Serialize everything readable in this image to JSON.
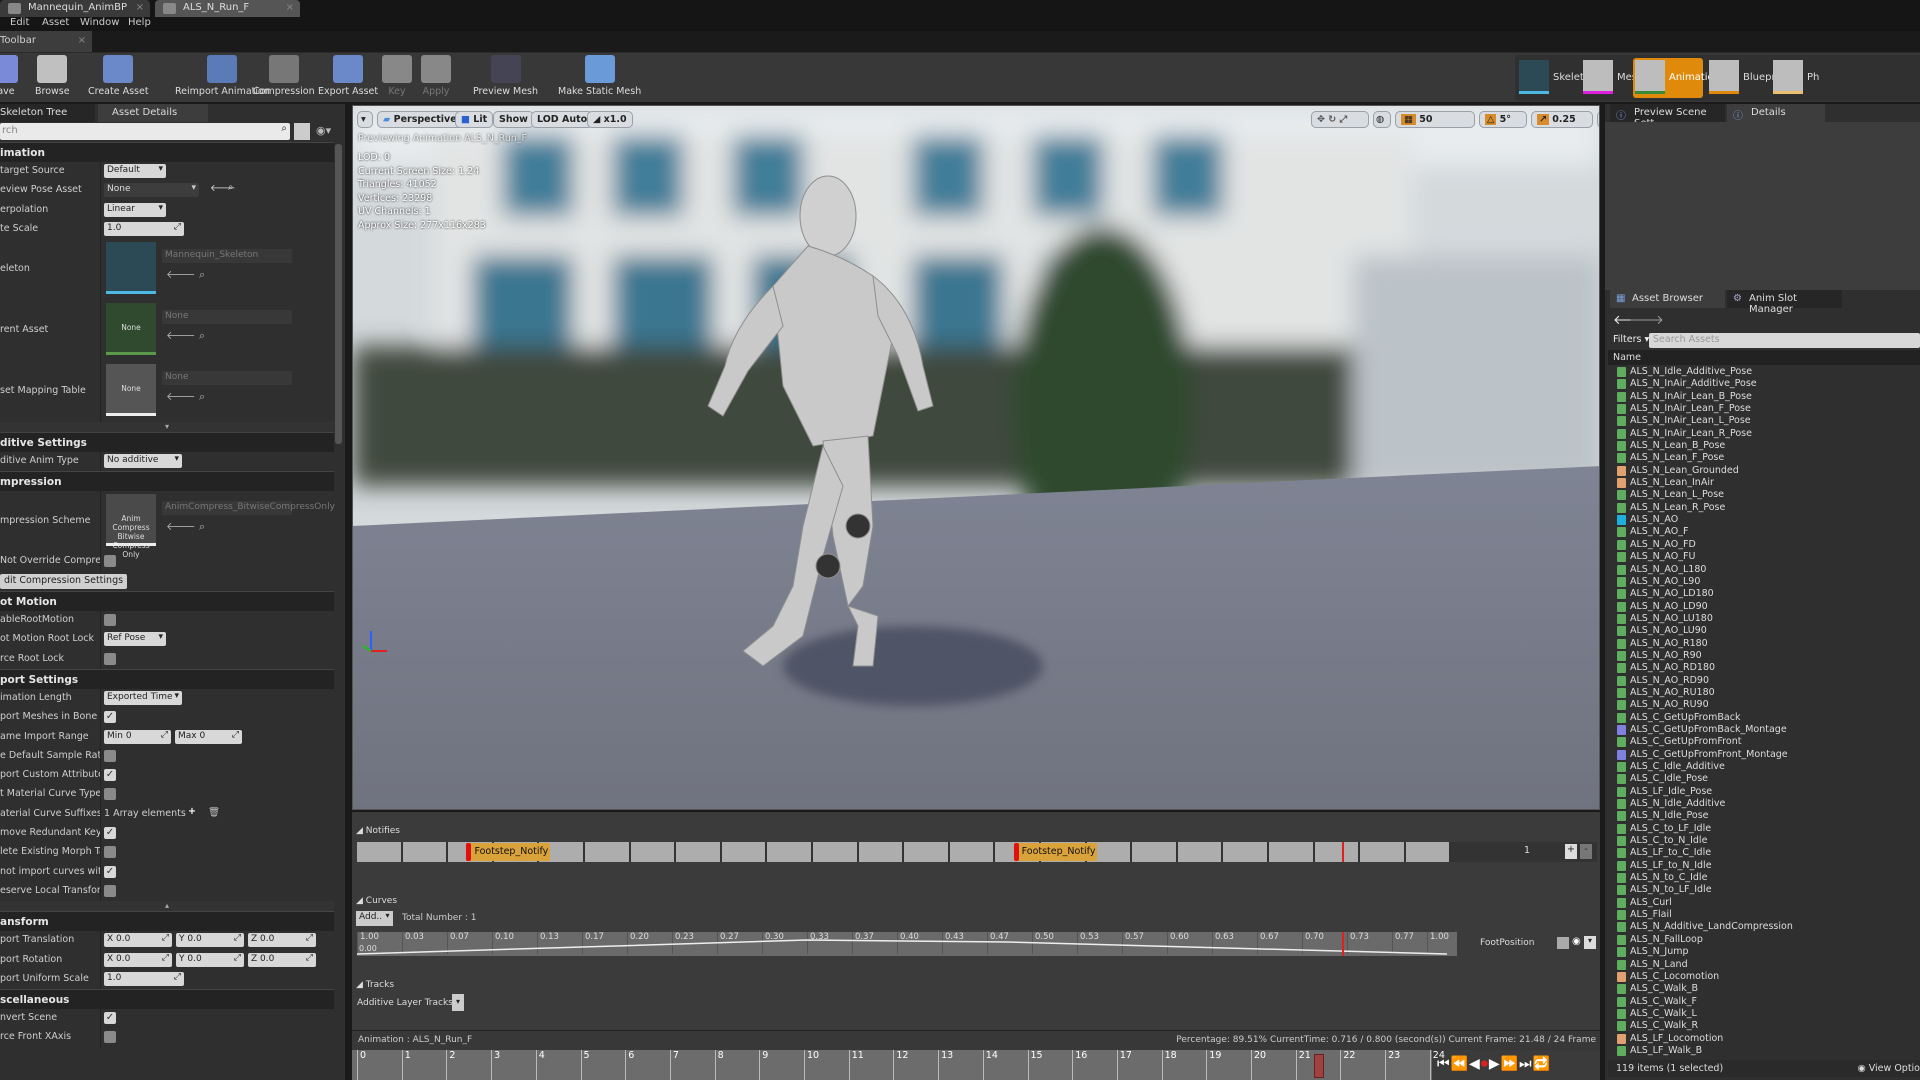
{
  "doc_tabs": [
    {
      "label": "Mannequin_AnimBP",
      "active": false
    },
    {
      "label": "ALS_N_Run_F",
      "active": true
    }
  ],
  "menu": [
    "Edit",
    "Asset",
    "Window",
    "Help"
  ],
  "toolbar_tab": "Toolbar",
  "toolbar": [
    {
      "label": "Save",
      "icon": "save-icon",
      "disabled": false
    },
    {
      "label": "Browse",
      "icon": "browse-icon",
      "disabled": false
    },
    {
      "label": "Create Asset",
      "icon": "create-asset-icon",
      "disabled": false
    },
    {
      "label": "Reimport Animation",
      "icon": "reimport-icon",
      "disabled": false
    },
    {
      "label": "Compression",
      "icon": "compression-icon",
      "disabled": false
    },
    {
      "label": "Export Asset",
      "icon": "export-icon",
      "disabled": false
    },
    {
      "label": "Key",
      "icon": "plus-icon",
      "disabled": true
    },
    {
      "label": "Apply",
      "icon": "check-icon",
      "disabled": true
    },
    {
      "label": "Preview Mesh",
      "icon": "preview-mesh-icon",
      "disabled": false
    },
    {
      "label": "Make Static Mesh",
      "icon": "static-mesh-icon",
      "disabled": false
    }
  ],
  "modes": [
    {
      "label": "Skeleton",
      "active": false,
      "color": "#4fb8e0"
    },
    {
      "label": "Mesh",
      "active": false,
      "color": "#e020e0"
    },
    {
      "label": "Animation",
      "active": true,
      "color": "#3a8a3a"
    },
    {
      "label": "Blueprint",
      "active": false,
      "color": "#e08a0b"
    },
    {
      "label": "Ph",
      "active": false,
      "color": "#e8c070"
    }
  ],
  "left_panel": {
    "tabs": [
      "Skeleton Tree",
      "Asset Details"
    ],
    "search_placeholder": "rch",
    "rows": [
      {
        "t": "sec",
        "label": "imation"
      },
      {
        "t": "dd",
        "label": "target Source",
        "value": "Default"
      },
      {
        "t": "dd2",
        "label": "eview Pose Asset",
        "value": "None"
      },
      {
        "t": "dd",
        "label": "erpolation",
        "value": "Linear"
      },
      {
        "t": "spin",
        "label": "te Scale",
        "value": "1.0"
      },
      {
        "t": "thumb",
        "label": "eleton",
        "thumb": "",
        "name": "Mannequin_Skeleton",
        "bg": "#2c4a56"
      },
      {
        "t": "thumb",
        "label": "rent Asset",
        "thumb": "None",
        "name": "None",
        "bg": "#2f4a2f"
      },
      {
        "t": "thumb",
        "label": "set Mapping Table",
        "thumb": "None",
        "name": "None",
        "bg": "#555555"
      },
      {
        "t": "arrow",
        "label": "▾"
      },
      {
        "t": "sec",
        "label": "ditive Settings"
      },
      {
        "t": "dd",
        "label": "ditive Anim Type",
        "value": "No additive"
      },
      {
        "t": "sec",
        "label": "mpression"
      },
      {
        "t": "thumb",
        "label": "mpression Scheme",
        "thumb": "Anim Compress Bitwise Compress Only",
        "name": "AnimCompress_BitwiseCompressOnly",
        "bg": "#4a4a4a"
      },
      {
        "t": "cb",
        "label": "Not Override Compressio",
        "checked": false
      },
      {
        "t": "btn",
        "label": "dit Compression Settings"
      },
      {
        "t": "sec",
        "label": "ot Motion"
      },
      {
        "t": "cb",
        "label": "ableRootMotion",
        "checked": false
      },
      {
        "t": "dd",
        "label": "ot Motion Root Lock",
        "value": "Ref Pose"
      },
      {
        "t": "cb",
        "label": "rce Root Lock",
        "checked": false
      },
      {
        "t": "sec",
        "label": "port Settings"
      },
      {
        "t": "dd",
        "label": "imation Length",
        "value": "Exported Time"
      },
      {
        "t": "cb",
        "label": "port Meshes in Bone Hiera",
        "checked": true
      },
      {
        "t": "range",
        "label": "ame Import Range",
        "values": [
          "Min  0",
          "Max  0"
        ]
      },
      {
        "t": "cb",
        "label": "e Default Sample Rate",
        "checked": false
      },
      {
        "t": "cb",
        "label": "port Custom Attribute",
        "checked": true
      },
      {
        "t": "cb",
        "label": "t Material Curve Type",
        "checked": false
      },
      {
        "t": "arr",
        "label": "aterial Curve Suffixes",
        "value": "1 Array elements"
      },
      {
        "t": "cb",
        "label": "move Redundant Keys",
        "checked": true
      },
      {
        "t": "cb",
        "label": "lete Existing Morph Target",
        "checked": false
      },
      {
        "t": "cb",
        "label": "not import curves with on",
        "checked": true
      },
      {
        "t": "cb",
        "label": "eserve Local Transform",
        "checked": false
      },
      {
        "t": "arrow",
        "label": "▴"
      },
      {
        "t": "sec",
        "label": "ansform"
      },
      {
        "t": "xyz",
        "label": "port Translation",
        "values": [
          "X  0.0",
          "Y  0.0",
          "Z  0.0"
        ]
      },
      {
        "t": "xyz",
        "label": "port Rotation",
        "values": [
          "X  0.0",
          "Y  0.0",
          "Z  0.0"
        ]
      },
      {
        "t": "spin",
        "label": "port Uniform Scale",
        "value": "1.0"
      },
      {
        "t": "sec",
        "label": "scellaneous"
      },
      {
        "t": "cb",
        "label": "nvert Scene",
        "checked": true
      },
      {
        "t": "cb",
        "label": "rce Front XAxis",
        "checked": false
      }
    ]
  },
  "viewport": {
    "buttons": [
      "Perspective",
      "Lit",
      "Show",
      "LOD Auto",
      "x1.0"
    ],
    "right_controls": [
      "50",
      "5°",
      "0.25",
      "4"
    ],
    "previewing": "Previewing Animation ALS_N_Run_F",
    "info": [
      "LOD: 0",
      "Current Screen Size: 1.24",
      "Triangles: 41052",
      "Vertices: 23298",
      "UV Channels: 1",
      "Approx Size: 277x116x283"
    ]
  },
  "right_panel": {
    "top_tabs": [
      "Preview Scene Sett",
      "Details"
    ],
    "browser_tabs": [
      "Asset Browser",
      "Anim Slot Manager"
    ],
    "filters": "Filters",
    "search_placeholder": "Search Assets",
    "column": "Name",
    "icon_colors": {
      "anim": "#5fae5f",
      "blend": "#e0a070",
      "aimoffset": "#20b0e0",
      "montage": "#8080e0"
    },
    "assets": [
      [
        "ALS_N_Idle_Additive_Pose",
        "anim"
      ],
      [
        "ALS_N_InAir_Additive_Pose",
        "anim"
      ],
      [
        "ALS_N_InAir_Lean_B_Pose",
        "anim"
      ],
      [
        "ALS_N_InAir_Lean_F_Pose",
        "anim"
      ],
      [
        "ALS_N_InAir_Lean_L_Pose",
        "anim"
      ],
      [
        "ALS_N_InAir_Lean_R_Pose",
        "anim"
      ],
      [
        "ALS_N_Lean_B_Pose",
        "anim"
      ],
      [
        "ALS_N_Lean_F_Pose",
        "anim"
      ],
      [
        "ALS_N_Lean_Grounded",
        "blend"
      ],
      [
        "ALS_N_Lean_InAir",
        "blend"
      ],
      [
        "ALS_N_Lean_L_Pose",
        "anim"
      ],
      [
        "ALS_N_Lean_R_Pose",
        "anim"
      ],
      [
        "ALS_N_AO",
        "aimoffset"
      ],
      [
        "ALS_N_AO_F",
        "anim"
      ],
      [
        "ALS_N_AO_FD",
        "anim"
      ],
      [
        "ALS_N_AO_FU",
        "anim"
      ],
      [
        "ALS_N_AO_L180",
        "anim"
      ],
      [
        "ALS_N_AO_L90",
        "anim"
      ],
      [
        "ALS_N_AO_LD180",
        "anim"
      ],
      [
        "ALS_N_AO_LD90",
        "anim"
      ],
      [
        "ALS_N_AO_LU180",
        "anim"
      ],
      [
        "ALS_N_AO_LU90",
        "anim"
      ],
      [
        "ALS_N_AO_R180",
        "anim"
      ],
      [
        "ALS_N_AO_R90",
        "anim"
      ],
      [
        "ALS_N_AO_RD180",
        "anim"
      ],
      [
        "ALS_N_AO_RD90",
        "anim"
      ],
      [
        "ALS_N_AO_RU180",
        "anim"
      ],
      [
        "ALS_N_AO_RU90",
        "anim"
      ],
      [
        "ALS_C_GetUpFromBack",
        "anim"
      ],
      [
        "ALS_C_GetUpFromBack_Montage",
        "montage"
      ],
      [
        "ALS_C_GetUpFromFront",
        "anim"
      ],
      [
        "ALS_C_GetUpFromFront_Montage",
        "montage"
      ],
      [
        "ALS_C_Idle_Additive",
        "anim"
      ],
      [
        "ALS_C_Idle_Pose",
        "anim"
      ],
      [
        "ALS_LF_Idle_Pose",
        "anim"
      ],
      [
        "ALS_N_Idle_Additive",
        "anim"
      ],
      [
        "ALS_N_Idle_Pose",
        "anim"
      ],
      [
        "ALS_C_to_LF_Idle",
        "anim"
      ],
      [
        "ALS_C_to_N_Idle",
        "anim"
      ],
      [
        "ALS_LF_to_C_Idle",
        "anim"
      ],
      [
        "ALS_LF_to_N_Idle",
        "anim"
      ],
      [
        "ALS_N_to_C_Idle",
        "anim"
      ],
      [
        "ALS_N_to_LF_Idle",
        "anim"
      ],
      [
        "ALS_Curl",
        "anim"
      ],
      [
        "ALS_Flail",
        "anim"
      ],
      [
        "ALS_N_Additive_LandCompression",
        "anim"
      ],
      [
        "ALS_N_FallLoop",
        "anim"
      ],
      [
        "ALS_N_Jump",
        "anim"
      ],
      [
        "ALS_N_Land",
        "anim"
      ],
      [
        "ALS_C_Locomotion",
        "blend"
      ],
      [
        "ALS_C_Walk_B",
        "anim"
      ],
      [
        "ALS_C_Walk_F",
        "anim"
      ],
      [
        "ALS_C_Walk_L",
        "anim"
      ],
      [
        "ALS_C_Walk_R",
        "anim"
      ],
      [
        "ALS_LF_Locomotion",
        "blend"
      ],
      [
        "ALS_LF_Walk_B",
        "anim"
      ]
    ],
    "footer": "119 items (1 selected)",
    "view_options": "View Optio"
  },
  "bottom": {
    "notifies_label": "Notifies",
    "notifies": [
      {
        "label": "Footstep_Notify",
        "frame": 2.4
      },
      {
        "label": "Footstep_Notify",
        "frame": 14.4
      }
    ],
    "track_count": "1",
    "curves_label": "Curves",
    "add_label": "Add...",
    "total": "Total Number : 1",
    "curve_ticks": [
      "1.00",
      "0.03",
      "0.07",
      "0.10",
      "0.13",
      "0.17",
      "0.20",
      "0.23",
      "0.27",
      "0.30",
      "0.33",
      "0.37",
      "0.40",
      "0.43",
      "0.47",
      "0.50",
      "0.53",
      "0.57",
      "0.60",
      "0.63",
      "0.67",
      "0.70",
      "0.73",
      "0.77",
      "1.00"
    ],
    "curve_min": "0.00",
    "curve_name": "FootPosition",
    "tracks_label": "Tracks",
    "additive_tracks": "Additive Layer Tracks",
    "animation": "Animation :  ALS_N_Run_F",
    "status": "Percentage:  89.51% CurrentTime:  0.716 / 0.800 (second(s)) Current Frame:  21.48 / 24 Frame",
    "frames": [
      "0",
      "1",
      "2",
      "3",
      "4",
      "5",
      "6",
      "7",
      "8",
      "9",
      "10",
      "11",
      "12",
      "13",
      "14",
      "15",
      "16",
      "17",
      "18",
      "19",
      "20",
      "21",
      "22",
      "23",
      "24"
    ],
    "current_frame": 21.48,
    "total_frames": 24
  }
}
